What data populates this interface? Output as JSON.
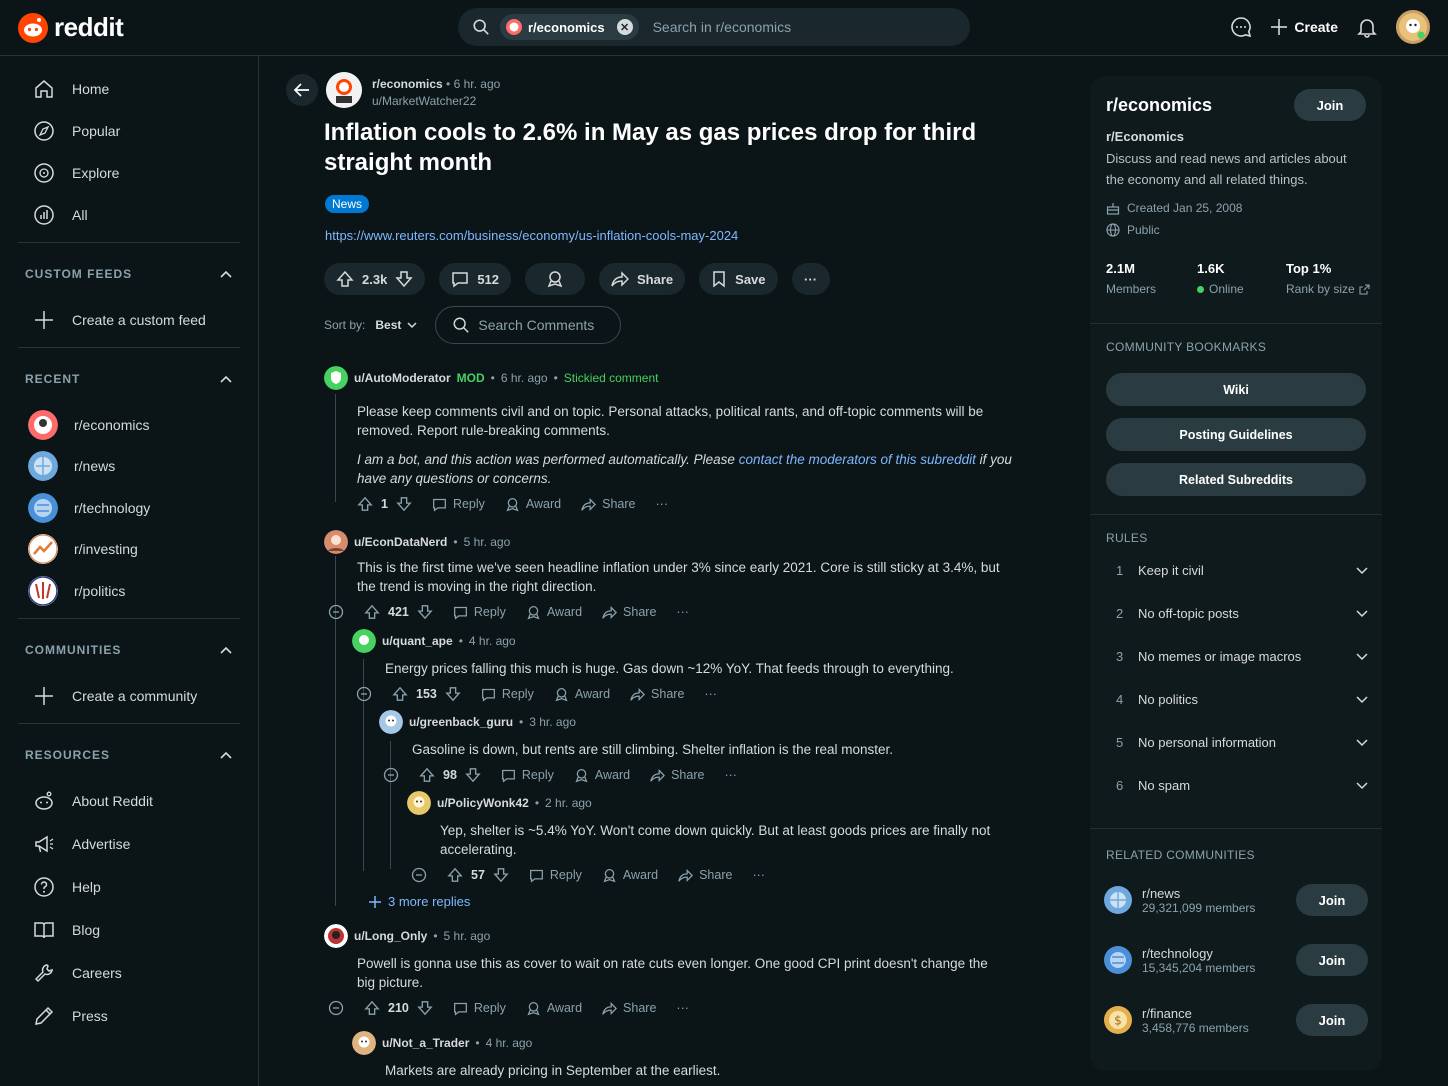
{
  "app": {
    "logo_text": "reddit"
  },
  "search": {
    "chip": "r/economics",
    "placeholder": "Search in r/economics"
  },
  "topbar": {
    "create_label": "Create"
  },
  "sidebar": {
    "nav": [
      {
        "label": "Home"
      },
      {
        "label": "Popular"
      },
      {
        "label": "Explore"
      },
      {
        "label": "All"
      }
    ],
    "custom_feeds": {
      "title": "CUSTOM FEEDS",
      "create": "Create a custom feed"
    },
    "recent": {
      "title": "RECENT",
      "items": [
        {
          "label": "r/economics"
        },
        {
          "label": "r/news"
        },
        {
          "label": "r/technology"
        },
        {
          "label": "r/investing"
        },
        {
          "label": "r/politics"
        }
      ]
    },
    "communities": {
      "title": "COMMUNITIES",
      "create": "Create a community"
    },
    "resources": {
      "title": "RESOURCES",
      "items": [
        {
          "label": "About Reddit"
        },
        {
          "label": "Advertise"
        },
        {
          "label": "Help"
        },
        {
          "label": "Blog"
        },
        {
          "label": "Careers"
        },
        {
          "label": "Press"
        }
      ]
    }
  },
  "post": {
    "subreddit": "r/economics",
    "time": "6 hr. ago",
    "author": "u/MarketWatcher22",
    "title": "Inflation cools to 2.6% in May as gas prices drop for third straight month",
    "flair": "News",
    "link": "https://www.reuters.com/business/economy/us-inflation-cools-may-2024",
    "score": "2.3k",
    "comments": "512",
    "share": "Share",
    "save": "Save",
    "sort_label": "Sort by:",
    "sort_value": "Best",
    "search_comments": "Search Comments"
  },
  "comment_actions": {
    "reply": "Reply",
    "award": "Award",
    "share": "Share"
  },
  "comments": {
    "automod": {
      "user": "u/AutoModerator",
      "mod": "MOD",
      "time": "6 hr. ago",
      "sticky": "Stickied comment",
      "body1": "Please keep comments civil and on topic. Personal attacks, political rants, and off-topic comments will be removed. Report rule-breaking comments.",
      "body2_a": "I am a bot, and this action was performed automatically. Please ",
      "body2_link": "contact the moderators of this subreddit",
      "body2_b": " if you have any questions or concerns.",
      "score": "1"
    },
    "econ": {
      "user": "u/EconDataNerd",
      "time": "5 hr. ago",
      "body": "This is the first time we've seen headline inflation under 3% since early 2021. Core is still sticky at 3.4%, but the trend is moving in the right direction.",
      "score": "421"
    },
    "quant": {
      "user": "u/quant_ape",
      "time": "4 hr. ago",
      "body": "Energy prices falling this much is huge. Gas down ~12% YoY. That feeds through to everything.",
      "score": "153"
    },
    "greenback": {
      "user": "u/greenback_guru",
      "time": "3 hr. ago",
      "body": "Gasoline is down, but rents are still climbing. Shelter inflation is the real monster.",
      "score": "98"
    },
    "policy": {
      "user": "u/PolicyWonk42",
      "time": "2 hr. ago",
      "body": "Yep, shelter is ~5.4% YoY. Won't come down quickly. But at least goods prices are finally not accelerating.",
      "score": "57"
    },
    "more_replies": "3 more replies",
    "longonly": {
      "user": "u/Long_Only",
      "time": "5 hr. ago",
      "body": "Powell is gonna use this as cover to wait on rate cuts even longer. One good CPI print doesn't change the big picture.",
      "score": "210"
    },
    "nottrader": {
      "user": "u/Not_a_Trader",
      "time": "4 hr. ago",
      "body": "Markets are already pricing in September at the earliest."
    }
  },
  "community": {
    "name": "r/economics",
    "join": "Join",
    "title": "r/Economics",
    "description": "Discuss and read news and articles about the economy and all related things.",
    "created": "Created Jan 25, 2008",
    "visibility": "Public",
    "members_value": "2.1M",
    "members_label": "Members",
    "online_value": "1.6K",
    "online_label": "Online",
    "rank_value": "Top 1%",
    "rank_label": "Rank by size",
    "bookmarks_title": "COMMUNITY BOOKMARKS",
    "bookmarks": [
      "Wiki",
      "Posting Guidelines",
      "Related Subreddits"
    ],
    "rules_title": "RULES",
    "rules": [
      {
        "num": "1",
        "text": "Keep it civil"
      },
      {
        "num": "2",
        "text": "No off-topic posts"
      },
      {
        "num": "3",
        "text": "No memes or image macros"
      },
      {
        "num": "4",
        "text": "No politics"
      },
      {
        "num": "5",
        "text": "No personal information"
      },
      {
        "num": "6",
        "text": "No spam"
      }
    ],
    "related_title": "RELATED COMMUNITIES",
    "related": [
      {
        "name": "r/news",
        "members": "29,321,099 members"
      },
      {
        "name": "r/technology",
        "members": "15,345,204 members"
      },
      {
        "name": "r/finance",
        "members": "3,458,776 members"
      }
    ]
  },
  "colors": {
    "accent": "#ff4500",
    "link": "#7eb8ff",
    "mod_green": "#46d160",
    "flair": "#0079d3"
  }
}
